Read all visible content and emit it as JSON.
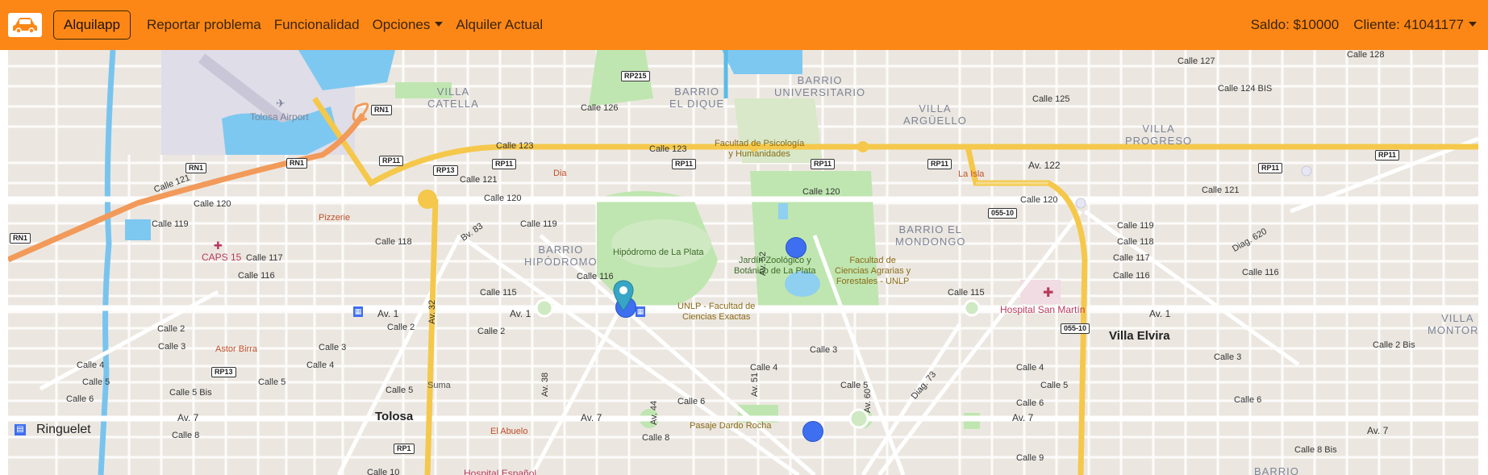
{
  "navbar": {
    "brand": "Alquilapp",
    "links": [
      "Reportar problema",
      "Funcionalidad",
      "Opciones",
      "Alquiler Actual"
    ],
    "saldo": "Saldo: $10000",
    "cliente": "Cliente: 41041177",
    "bg_color": "#fd8716"
  },
  "map": {
    "labels": {
      "tolosa_airport": "Tolosa Airport",
      "villa_catella": "VILLA\nCATELLA",
      "barrio_el_dique": "BARRIO\nEL DIQUE",
      "barrio_universitario": "BARRIO\nUNIVERSITARIO",
      "villa_arguello": "VILLA\nARGÜELLO",
      "villa_progreso": "VILLA\nPROGRESO",
      "barrio_hipodromo": "BARRIO\nHIPÓDROMO",
      "barrio_el_mondongo": "BARRIO EL\nMONDONGO",
      "villa_montoro": "VILLA\nMONTORO",
      "barrio": "BARRIO",
      "villa_elvira": "Villa Elvira",
      "tolosa": "Tolosa",
      "ringuelet": "Ringuelet",
      "facultad_psicologia": "Facultad de Psicología\ny Humanidades",
      "hipodromo": "Hipódromo de La Plata",
      "jardin_zoologico": "Jardín Zoológico y\nBotánico de La Plata",
      "facultad_agrarias": "Facultad de\nCiencias Agrarias y\nForestales - UNLP",
      "unlp_exactas": "UNLP - Facultad de\nCiencias Exactas",
      "pasaje_dardo_rocha": "Pasaje Dardo Rocha",
      "hospital_san_martin": "Hospital San Martín",
      "hospital_espanol": "Hospital Español",
      "caps15": "CAPS 15",
      "dia": "Dia",
      "la_isla": "La Isla",
      "pizzerie": "Pizzerie",
      "astor_birra": "Astor Birra",
      "el_abuelo": "El Abuelo",
      "suma": "Suma"
    },
    "avenues": {
      "av122": "Av. 122",
      "av1_left": "Av. 1",
      "av1_mid": "Av. 1",
      "av1_right": "Av. 1",
      "av7_left": "Av. 7",
      "av7_mid": "Av. 7",
      "av7_right": "Av. 7",
      "av7_far": "Av. 7",
      "av32": "Av. 32",
      "av52": "Av. 52",
      "av51": "Av. 51",
      "av44": "Av. 44",
      "av38": "Av. 38",
      "av60": "Av. 60",
      "bv83": "Bv. 83",
      "diag73": "Diag. 73",
      "diag620": "Diag. 620"
    },
    "streets": {
      "c120a": "Calle 120",
      "c120b": "Calle 120",
      "c120c": "Calle 120",
      "c120d": "Calle 120",
      "c119a": "Calle 119",
      "c119b": "Calle 119",
      "c119c": "Calle 119",
      "c118a": "Calle 118",
      "c118b": "Calle 118",
      "c117a": "Calle 117",
      "c117b": "Calle 117",
      "c116a": "Calle 116",
      "c116b": "Calle 116",
      "c116c": "Calle 116",
      "c116d": "Calle 116",
      "c115a": "Calle 115",
      "c115b": "Calle 115",
      "c2a": "Calle 2",
      "c2b": "Calle 2",
      "c2c": "Calle 2",
      "c3a": "Calle 3",
      "c3b": "Calle 3",
      "c3c": "Calle 3",
      "c3d": "Calle 3",
      "c4a": "Calle 4",
      "c4b": "Calle 4",
      "c4c": "Calle 4",
      "c4d": "Calle 4",
      "c5a": "Calle 5",
      "c5b": "Calle 5",
      "c5c": "Calle 5",
      "c5d": "Calle 5",
      "c5e": "Calle 5",
      "c6a": "Calle 6",
      "c6b": "Calle 6",
      "c6c": "Calle 6",
      "c6d": "Calle 6",
      "c8a": "Calle 8",
      "c8b": "Calle 8",
      "c121a": "Calle 121",
      "c121b": "Calle 121",
      "c121c": "Calle 121",
      "c123a": "Calle 123",
      "c123b": "Calle 123",
      "c125": "Calle 125",
      "c126": "Calle 126",
      "c127": "Calle 127",
      "c128": "Calle 128",
      "c124bis": "Calle 124 BIS",
      "c2bis": "Calle 2 Bis",
      "c5bis": "Calle 5 Bis",
      "c9": "Calle 9",
      "c10": "Calle 10",
      "c8bis": "Calle 8 Bis",
      "c1": "Av. 1"
    },
    "shields": {
      "rp215": "RP215",
      "rn1a": "RN1",
      "rn1b": "RN1",
      "rn1c": "RN1",
      "rn1d": "RN1",
      "rp11a": "RP11",
      "rp11b": "RP11",
      "rp11c": "RP11",
      "rp11d": "RP11",
      "rp11e": "RP11",
      "rp11f": "RP11",
      "rp11g": "RP11",
      "rp13a": "RP13",
      "rp13b": "RP13",
      "rp1": "RP1",
      "r05510a": "055-10",
      "r05510b": "055-10"
    }
  }
}
